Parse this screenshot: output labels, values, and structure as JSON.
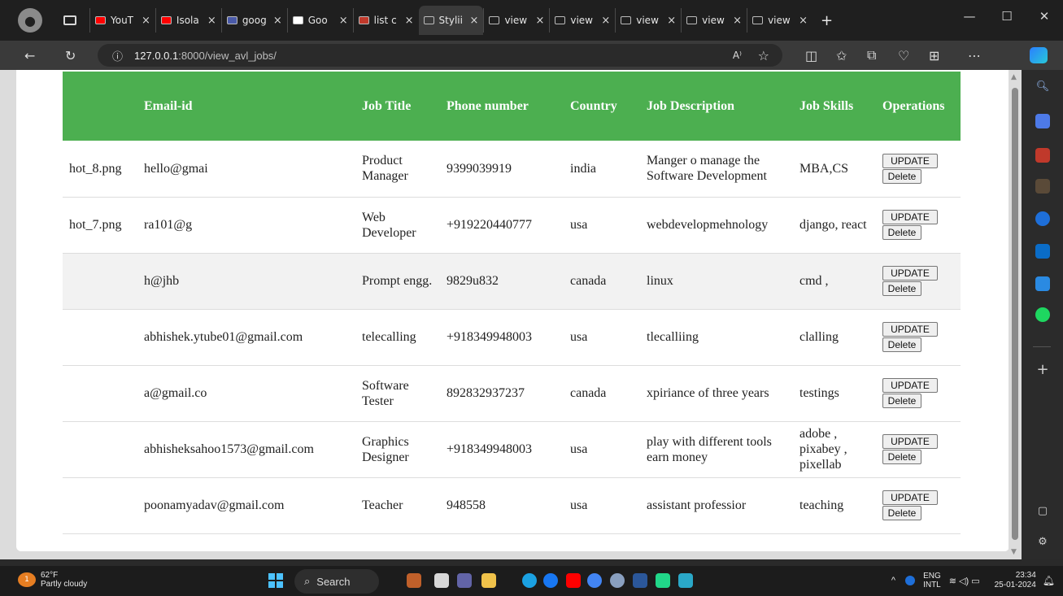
{
  "browser": {
    "tabs": [
      {
        "label": "YouT",
        "icon_color": "#ff0000",
        "icon": "youtube-icon"
      },
      {
        "label": "Isola",
        "icon_color": "#ff0000",
        "icon": "youtube-icon"
      },
      {
        "label": "goog",
        "icon_color": "#4a5aa8",
        "icon": "search-icon"
      },
      {
        "label": "Goo",
        "icon_color": "#ffffff",
        "icon": "google-icon"
      },
      {
        "label": "list c",
        "icon_color": "#c0392b",
        "icon": "site-icon"
      },
      {
        "label": "Stylii",
        "icon_color": "#3a3a3a",
        "icon": "page-icon",
        "active": true
      },
      {
        "label": "view",
        "icon_color": "#1f1f1f",
        "icon": "page-icon"
      },
      {
        "label": "view",
        "icon_color": "#1f1f1f",
        "icon": "page-icon"
      },
      {
        "label": "view",
        "icon_color": "#1f1f1f",
        "icon": "page-icon"
      },
      {
        "label": "view",
        "icon_color": "#1f1f1f",
        "icon": "page-icon"
      },
      {
        "label": "view",
        "icon_color": "#1f1f1f",
        "icon": "page-icon"
      }
    ],
    "tab_close": "×",
    "new_tab": "+",
    "address": {
      "host": "127.0.0.1",
      "rest": ":8000/view_avl_jobs/"
    },
    "window_controls": {
      "minimize": "—",
      "maximize": "☐",
      "close": "✕"
    },
    "nav": {
      "back": "←",
      "reload": "↻",
      "info": "ⓘ"
    }
  },
  "table": {
    "headers": [
      "",
      "Email-id",
      "Job Title",
      "Phone number",
      "Country",
      "Job Description",
      "Job Skills",
      "Operations"
    ],
    "header_color": "#4caf50",
    "rows": [
      {
        "file": "hot_8.png",
        "email": "hello@gmai",
        "title": "Product Manager",
        "phone": "9399039919",
        "country": "india",
        "desc": "Manger o manage the Software Development",
        "skills": "MBA,CS"
      },
      {
        "file": "hot_7.png",
        "email": "ra101@g",
        "title": "Web Developer",
        "phone": "+919220440777",
        "country": "usa",
        "desc": "webdevelopmehnology",
        "skills": "django, react"
      },
      {
        "file": "",
        "email": "h@jhb",
        "title": "Prompt engg.",
        "phone": "9829u832",
        "country": "canada",
        "desc": "linux",
        "skills": "cmd ,"
      },
      {
        "file": "",
        "email": "abhishek.ytube01@gmail.com",
        "title": "telecalling",
        "phone": "+918349948003",
        "country": "usa",
        "desc": "tlecalliing",
        "skills": "clalling"
      },
      {
        "file": "",
        "email": "a@gmail.co",
        "title": "Software Tester",
        "phone": "892832937237",
        "country": "canada",
        "desc": "xpiriance of three years",
        "skills": "testings"
      },
      {
        "file": "",
        "email": "abhisheksahoo1573@gmail.com",
        "title": "Graphics Designer",
        "phone": "+918349948003",
        "country": "usa",
        "desc": "play with different tools earn money",
        "skills": "adobe , pixabey , pixellab"
      },
      {
        "file": "",
        "email": "poonamyadav@gmail.com",
        "title": "Teacher",
        "phone": "948558",
        "country": "usa",
        "desc": "assistant professior",
        "skills": "teaching"
      }
    ],
    "update_label": "UPDATE",
    "delete_label": "Delete"
  },
  "taskbar": {
    "weather_temp": "62°F",
    "weather_desc": "Partly cloudy",
    "search_label": "Search",
    "lang_line1": "ENG",
    "lang_line2": "INTL",
    "time": "23:34",
    "date": "25-01-2024",
    "weather_badge": "1"
  }
}
